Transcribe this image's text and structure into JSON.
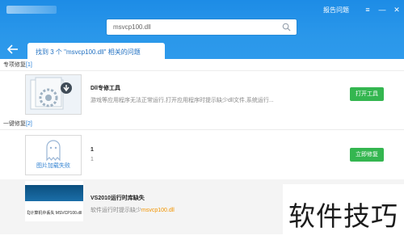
{
  "header": {
    "search_value": "msvcp100.dll",
    "feedback": "报告问题",
    "menu_glyph": "≡",
    "minimize_glyph": "—",
    "close_glyph": "✕"
  },
  "tab": {
    "prefix": "找到 3 个",
    "query": "\"msvcp100.dll\"",
    "suffix": "相关的问题"
  },
  "sections": {
    "special": {
      "label": "专项修复",
      "count": "[1]"
    },
    "oneclick": {
      "label": "一键修复",
      "count": "[2]"
    }
  },
  "items": [
    {
      "title": "Dll专修工具",
      "desc": "游戏等应用程序无法正常运行,打开应用程序时提示缺少dll文件,系统运行...",
      "button": "打开工具"
    },
    {
      "title": "1",
      "desc": "1",
      "thumb_text": "图片加载失败",
      "button": "立即修复"
    },
    {
      "title": "VS2010运行时库缺失",
      "desc_prefix": "软件运行时提示缺少",
      "desc_highlight": "msvcp100.dll",
      "thumb_caption": "【]计算机中丢失 MSVCP100.dll"
    }
  ],
  "watermark": "软件技巧",
  "colors": {
    "header_blue": "#2a97ea",
    "link_blue": "#1f6fc1",
    "button_green": "#34b650",
    "highlight_orange": "#f29400"
  }
}
